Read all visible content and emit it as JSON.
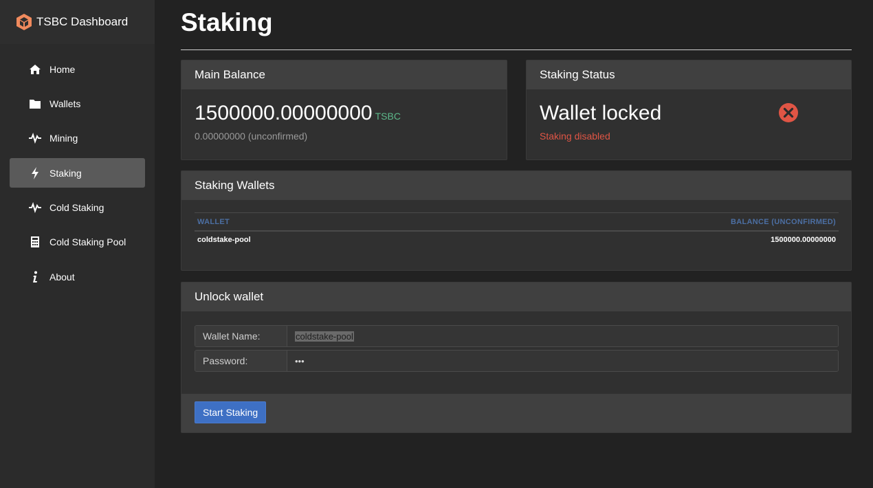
{
  "brand": {
    "title": "TSBC Dashboard"
  },
  "sidebar": {
    "items": [
      {
        "label": "Home",
        "icon": "home-icon",
        "active": false
      },
      {
        "label": "Wallets",
        "icon": "folder-icon",
        "active": false
      },
      {
        "label": "Mining",
        "icon": "pulse-icon",
        "active": false
      },
      {
        "label": "Staking",
        "icon": "bolt-icon",
        "active": true
      },
      {
        "label": "Cold Staking",
        "icon": "pulse-icon",
        "active": false
      },
      {
        "label": "Cold Staking Pool",
        "icon": "calculator-icon",
        "active": false
      },
      {
        "label": "About",
        "icon": "info-icon",
        "active": false
      }
    ]
  },
  "page": {
    "title": "Staking"
  },
  "main_balance": {
    "header": "Main Balance",
    "amount": "1500000.00000000",
    "unit": "TSBC",
    "unconfirmed": "0.00000000 (unconfirmed)"
  },
  "staking_status": {
    "header": "Staking Status",
    "status": "Wallet locked",
    "detail": "Staking disabled",
    "icon": "error-circle-icon"
  },
  "staking_wallets": {
    "header": "Staking Wallets",
    "columns": [
      "WALLET",
      "BALANCE (UNCONFIRMED)"
    ],
    "rows": [
      {
        "wallet": "coldstake-pool",
        "balance": "1500000.00000000"
      }
    ]
  },
  "unlock": {
    "header": "Unlock wallet",
    "wallet_label": "Wallet Name:",
    "wallet_value": "coldstake-pool",
    "password_label": "Password:",
    "password_mask": "•••",
    "submit": "Start Staking"
  },
  "colors": {
    "background": "#222222",
    "sidebar": "#2b2b2b",
    "accent": "#3e70c4",
    "success": "#5cb88a",
    "danger": "#e05545",
    "logo": "#f08a5d"
  }
}
